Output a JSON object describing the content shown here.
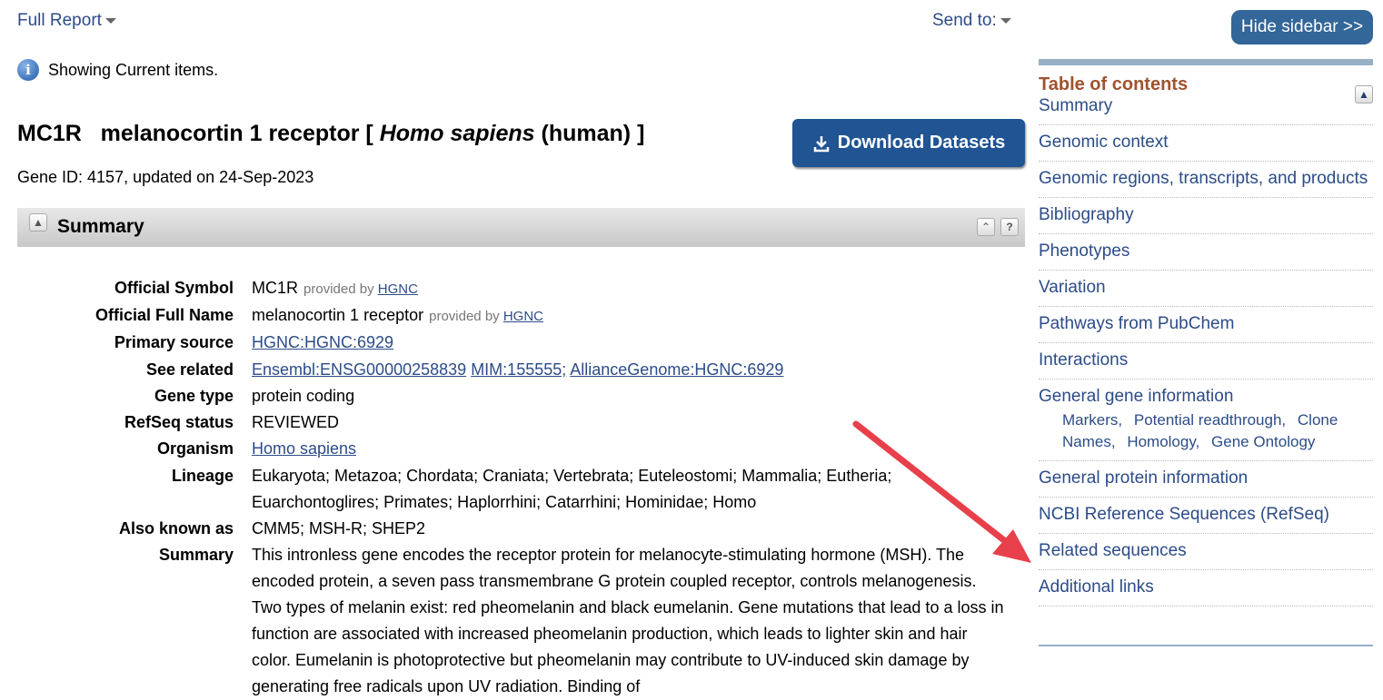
{
  "header": {
    "full_report": "Full Report",
    "send_to": "Send to:",
    "hide_sidebar": "Hide sidebar >>"
  },
  "notice": "Showing Current items.",
  "gene": {
    "title": "MC1R   melanocortin 1 receptor [ ",
    "species_italic": "Homo sapiens",
    "title_end": " (human) ]",
    "id_line": "Gene ID: 4157, updated on 24-Sep-2023",
    "download": "Download Datasets"
  },
  "summary_section": {
    "title": "Summary",
    "rows": {
      "symbol": {
        "label": "Official Symbol",
        "value": "MC1R",
        "provided": "provided by",
        "link": "HGNC"
      },
      "fullname": {
        "label": "Official Full Name",
        "value": "melanocortin 1 receptor",
        "provided": "provided by",
        "link": "HGNC"
      },
      "primary": {
        "label": "Primary source",
        "link": "HGNC:HGNC:6929"
      },
      "related": {
        "label": "See related",
        "links": [
          "Ensembl:ENSG00000258839",
          "MIM:155555;",
          "AllianceGenome:HGNC:6929"
        ]
      },
      "genetype": {
        "label": "Gene type",
        "value": "protein coding"
      },
      "refseq": {
        "label": "RefSeq status",
        "value": "REVIEWED"
      },
      "organism": {
        "label": "Organism",
        "link": "Homo sapiens"
      },
      "lineage": {
        "label": "Lineage",
        "value": "Eukaryota; Metazoa; Chordata; Craniata; Vertebrata; Euteleostomi; Mammalia; Eutheria; Euarchontoglires; Primates; Haplorrhini; Catarrhini; Hominidae; Homo"
      },
      "aka": {
        "label": "Also known as",
        "value": "CMM5; MSH-R; SHEP2"
      },
      "summary": {
        "label": "Summary",
        "value": "This intronless gene encodes the receptor protein for melanocyte-stimulating hormone (MSH). The encoded protein, a seven pass transmembrane G protein coupled receptor, controls melanogenesis. Two types of melanin exist: red pheomelanin and black eumelanin. Gene mutations that lead to a loss in function are associated with increased pheomelanin production, which leads to lighter skin and hair color. Eumelanin is photoprotective but pheomelanin may contribute to UV-induced skin damage by generating free radicals upon UV radiation. Binding of"
      }
    }
  },
  "sidebar": {
    "toc_title": "Table of contents",
    "items": [
      "Summary",
      "Genomic context",
      "Genomic regions, transcripts, and products",
      "Bibliography",
      "Phenotypes",
      "Variation",
      "Pathways from PubChem",
      "Interactions",
      "General gene information",
      "General protein information",
      "NCBI Reference Sequences (RefSeq)",
      "Related sequences",
      "Additional links"
    ],
    "subitems": [
      "Markers,",
      "Potential readthrough,",
      "Clone Names,",
      "Homology,",
      "Gene Ontology"
    ]
  },
  "colors": {
    "link": "#2c4c88",
    "toc_title": "#a0522d",
    "button": "#205493",
    "annotation_arrow": "#e8404a"
  }
}
